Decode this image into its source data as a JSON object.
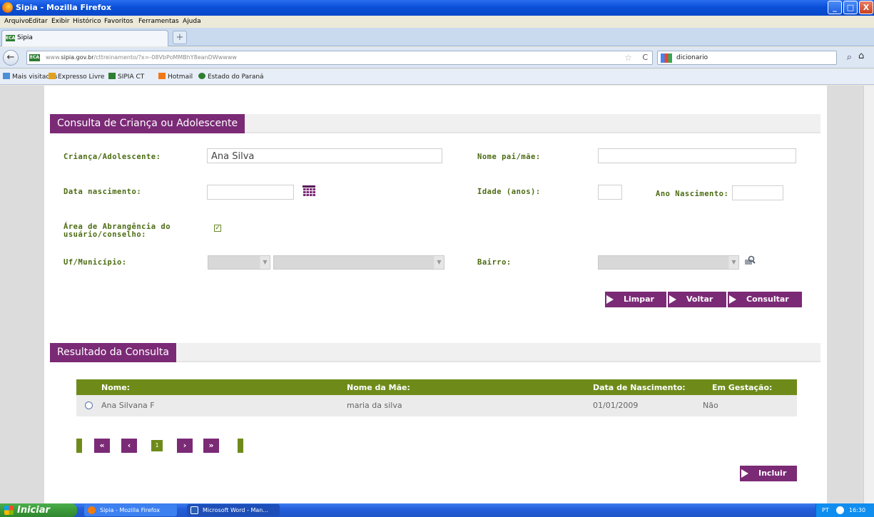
{
  "window": {
    "title": "Sipia - Mozilla Firefox",
    "buttons": [
      "_",
      "□",
      "X"
    ]
  },
  "menu": [
    "Arquivo",
    "Editar",
    "Exibir",
    "Histórico",
    "Favoritos",
    "Ferramentas",
    "Ajuda"
  ],
  "tab": {
    "badge": "ECA",
    "label": "Sipia",
    "new_tab": "+"
  },
  "nav": {
    "back": "←",
    "url_prefix": "www.",
    "url_domain": "sipia.gov.br",
    "url_rest": "/cttreinamento/?x=-08VbPoMMBhY8eanDWwwww",
    "star": "☆",
    "reload": "C",
    "search_text": "dicionario",
    "search_icon": "⌕",
    "home": "⌂"
  },
  "bookmarks": [
    {
      "label": "Mais visitados",
      "icon_color": "#4a90d9"
    },
    {
      "label": "Expresso Livre",
      "icon_color": "#e0a020"
    },
    {
      "label": "SIPIA CT",
      "icon_color": "#2e7d32"
    },
    {
      "label": "Hotmail",
      "icon_color": "#f07818"
    },
    {
      "label": "Estado do Paraná",
      "icon_color": "#2e7d32"
    }
  ],
  "form": {
    "section_title": "Consulta de Criança ou Adolescente",
    "crianca_label": "Criança/Adolescente:",
    "crianca_value": "Ana Silva",
    "nome_pai_label": "Nome pai/mãe:",
    "nome_pai_value": "",
    "data_nasc_label": "Data nascimento:",
    "data_nasc_value": "",
    "idade_label": "Idade (anos):",
    "idade_value": "",
    "ano_nasc_label": "Ano Nascimento:",
    "ano_nasc_value": "",
    "area_label_1": "Área de Abrangência do",
    "area_label_2": "usuário/conselho:",
    "area_checked": "✓",
    "uf_label": "Uf/Município:",
    "bairro_label": "Bairro:",
    "dropdown_arrow": "▼"
  },
  "actions": {
    "limpar": "Limpar",
    "voltar": "Voltar",
    "consultar": "Consultar"
  },
  "results": {
    "section_title": "Resultado da Consulta",
    "columns": [
      "Nome:",
      "Nome da Mãe:",
      "Data de Nascimento:",
      "Em Gestação:"
    ],
    "rows": [
      {
        "nome": "Ana Silvana F",
        "mae": "maria da silva",
        "nascimento": "01/01/2009",
        "gestacao": "Não"
      }
    ]
  },
  "pagination": {
    "first": "«",
    "prev": "‹",
    "page": "1",
    "next": "›",
    "last": "»"
  },
  "incluir": "Incluir",
  "taskbar": {
    "start": "Iniciar",
    "tasks": [
      {
        "label": "Sipia - Mozilla Firefox",
        "color": "#f07b12"
      },
      {
        "label": "Microsoft Word - Man...",
        "color": "#2b5fb0"
      }
    ],
    "tray_lang": "PT",
    "tray_time": "16:30"
  }
}
